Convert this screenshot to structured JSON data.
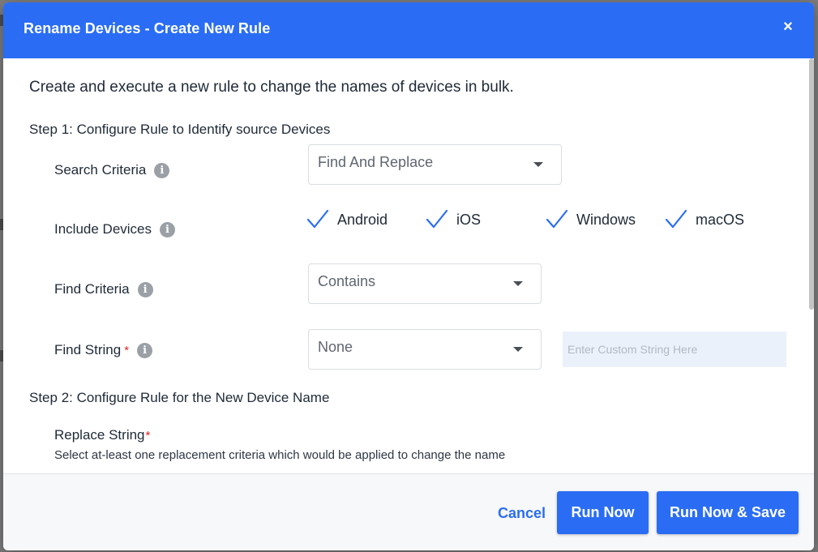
{
  "dialog": {
    "title": "Rename Devices - Create New Rule",
    "close_glyph": "×",
    "intro": "Create and execute a new rule to change the names of devices in bulk."
  },
  "step1": {
    "title": "Step 1: Configure Rule to Identify source Devices",
    "search_criteria": {
      "label": "Search Criteria",
      "value": "Find And Replace"
    },
    "include_devices": {
      "label": "Include Devices",
      "options": [
        {
          "label": "Android",
          "checked": true
        },
        {
          "label": "iOS",
          "checked": true
        },
        {
          "label": "Windows",
          "checked": true
        },
        {
          "label": "macOS",
          "checked": true
        }
      ]
    },
    "find_criteria": {
      "label": "Find Criteria",
      "value": "Contains"
    },
    "find_string": {
      "label": "Find String",
      "required_mark": "*",
      "value": "None",
      "custom_placeholder": "Enter Custom String Here"
    }
  },
  "step2": {
    "title": "Step 2: Configure Rule for the New Device Name",
    "replace_string": {
      "label": "Replace String",
      "required_mark": "*",
      "hint": "Select at-least one replacement criteria which would be applied to change the name"
    }
  },
  "footer": {
    "cancel_label": "Cancel",
    "run_now_label": "Run Now",
    "run_now_save_label": "Run Now & Save"
  },
  "icons": {
    "info": "i",
    "close": "close-icon",
    "check": "check-icon",
    "caret": "chevron-down-icon"
  },
  "colors": {
    "accent": "#2a6df4",
    "required": "#e02424",
    "input_fill": "#eaf1fb"
  }
}
